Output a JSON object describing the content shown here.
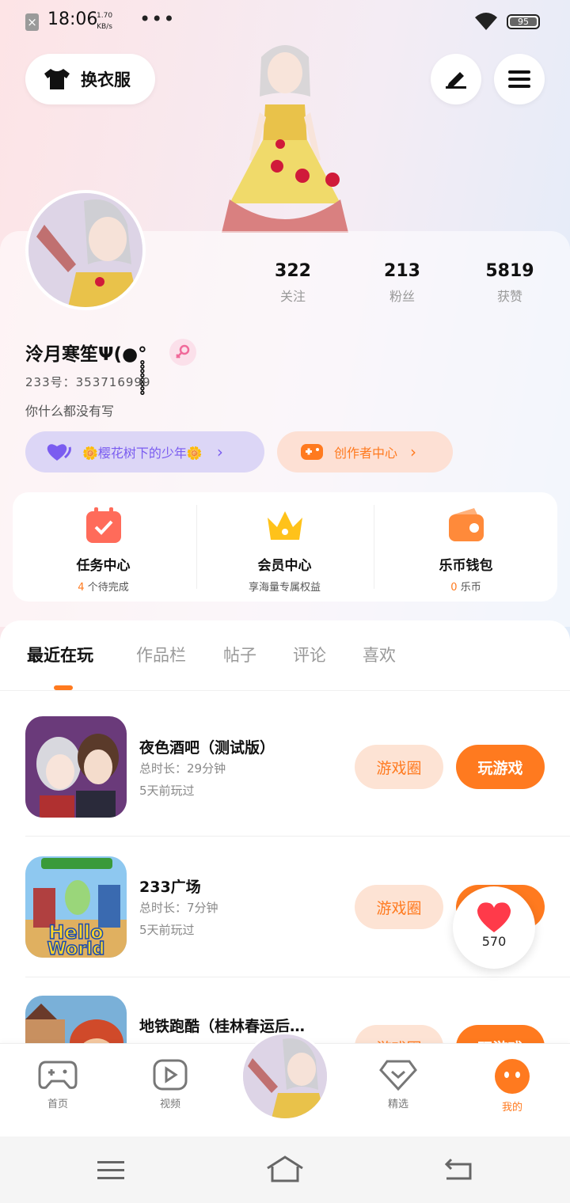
{
  "status_bar": {
    "time": "18:06",
    "speed_value": "1.70",
    "speed_unit": "KB/s",
    "more": "•••",
    "battery": "95"
  },
  "top": {
    "outfit_label": "换衣服",
    "edit_icon": "edit-icon",
    "menu_icon": "menu-icon"
  },
  "profile": {
    "stats": [
      {
        "value": "322",
        "label": "关注"
      },
      {
        "value": "213",
        "label": "粉丝"
      },
      {
        "value": "5819",
        "label": "获赞"
      }
    ],
    "username": "泠月寒笙Ψ(●°̥̥̥̥̥̥̥̥",
    "uid": "233号：353716999",
    "bio": "你什么都没有写",
    "pill_group": "🌼樱花树下的少年🌼",
    "pill_creator": "创作者中心"
  },
  "features": [
    {
      "title": "任务中心",
      "sub_num": "4",
      "sub_text": "个待完成"
    },
    {
      "title": "会员中心",
      "sub_num": "",
      "sub_text": "享海量专属权益"
    },
    {
      "title": "乐币钱包",
      "sub_num": "0",
      "sub_text": "乐币"
    }
  ],
  "tabs": [
    "最近在玩",
    "作品栏",
    "帖子",
    "评论",
    "喜欢"
  ],
  "games": [
    {
      "title": "夜色酒吧（测试版）",
      "duration": "总时长：29分钟",
      "last": "5天前玩过",
      "circle_btn": "游戏圈",
      "play_btn": "玩游戏"
    },
    {
      "title": "233广场",
      "duration": "总时长：7分钟",
      "last": "5天前玩过",
      "circle_btn": "游戏圈",
      "play_btn": "玩游戏"
    },
    {
      "title": "地铁跑酷（桂林春运后…",
      "duration": "",
      "last": "",
      "circle_btn": "游戏圈",
      "play_btn": "玩游戏"
    }
  ],
  "game2_art_text": "Hello World",
  "heart_count": "570",
  "nav": [
    {
      "label": "首页"
    },
    {
      "label": "视频"
    },
    {
      "label": "精选"
    },
    {
      "label": "我的"
    }
  ],
  "colors": {
    "accent": "#ff7a1f",
    "purple_pill": "#dcd6f6",
    "peach_pill": "#fde0d4"
  }
}
